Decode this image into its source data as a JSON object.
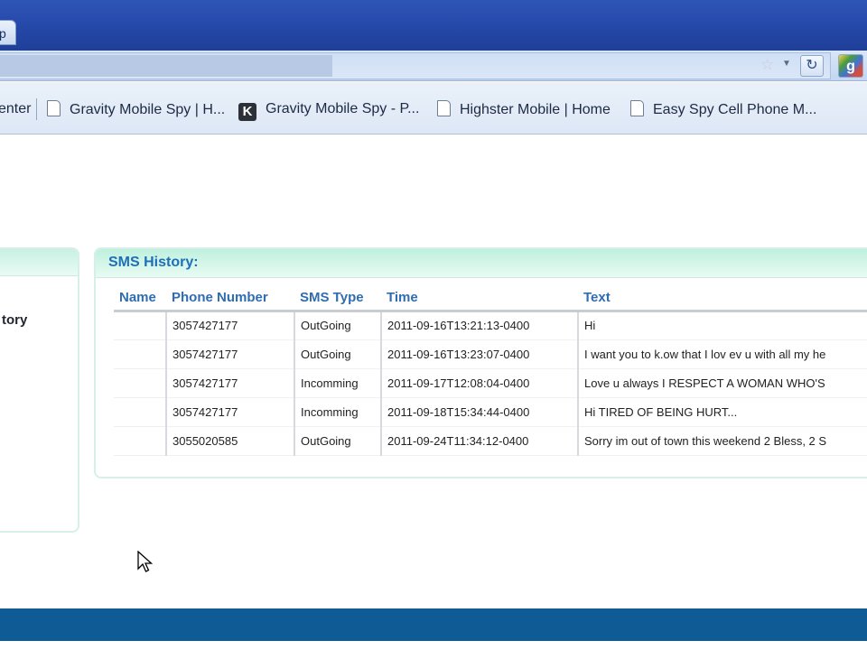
{
  "browser": {
    "tab_fragment": "p",
    "bookmarks": [
      {
        "label": "enter",
        "icon": "none"
      },
      {
        "label": "Gravity Mobile Spy | H...",
        "icon": "page-icon"
      },
      {
        "label": "Gravity Mobile Spy - P...",
        "icon": "k-icon"
      },
      {
        "label": "Highster Mobile | Home",
        "icon": "page-icon"
      },
      {
        "label": "Easy Spy Cell Phone M...",
        "icon": "page-icon"
      }
    ],
    "google_icon_letter": "g"
  },
  "sidebar": {
    "item_label": "tory"
  },
  "sms_history": {
    "title": "SMS History:",
    "columns": [
      "Name",
      "Phone Number",
      "SMS Type",
      "Time",
      "Text"
    ],
    "rows": [
      {
        "name": "",
        "phone": "3057427177",
        "type": "OutGoing",
        "time": "2011-09-16T13:21:13-0400",
        "text": "Hi"
      },
      {
        "name": "",
        "phone": "3057427177",
        "type": "OutGoing",
        "time": "2011-09-16T13:23:07-0400",
        "text": "I want you to k.ow that I lov ev u with all my he"
      },
      {
        "name": "",
        "phone": "3057427177",
        "type": "Incomming",
        "time": "2011-09-17T12:08:04-0400",
        "text": "Love u always I RESPECT A WOMAN WHO'S"
      },
      {
        "name": "",
        "phone": "3057427177",
        "type": "Incomming",
        "time": "2011-09-18T15:34:44-0400",
        "text": "Hi TIRED OF BEING HURT..."
      },
      {
        "name": "",
        "phone": "3055020585",
        "type": "OutGoing",
        "time": "2011-09-24T11:34:12-0400",
        "text": "Sorry im out of town this weekend 2 Bless, 2 S"
      }
    ]
  },
  "colors": {
    "title_blue": "#1f6fb8",
    "header_mint": "#bff0dd",
    "footer_blue": "#0e5b96"
  }
}
